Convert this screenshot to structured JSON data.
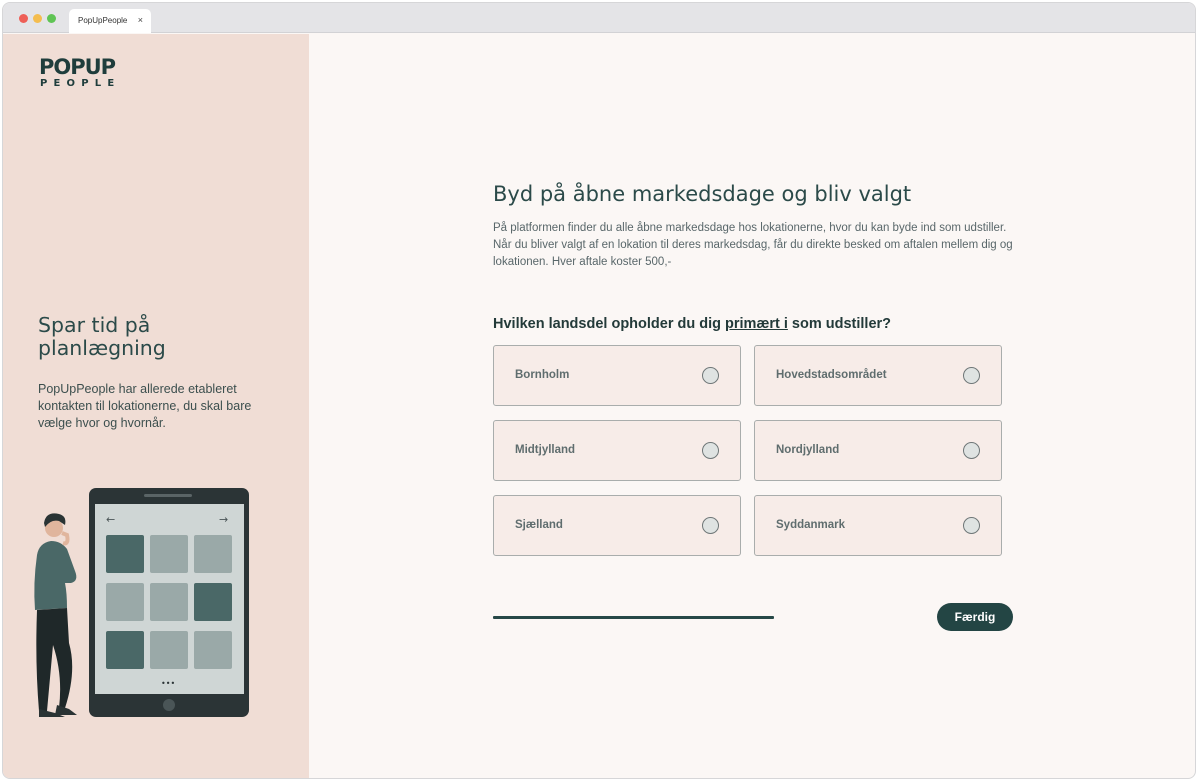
{
  "browser": {
    "tab_title": "PopUpPeople",
    "tab_close": "×"
  },
  "logo": {
    "line1": "POPUP",
    "line2": "PEOPLE"
  },
  "sidebar": {
    "title": "Spar tid på planlægning",
    "text": "PopUpPeople har allerede etableret kontakten til lokationerne, du skal bare vælge hvor og hvornår."
  },
  "illustration": {
    "arrow_left": "←",
    "arrow_right": "→",
    "dots": "•••"
  },
  "main": {
    "title": "Byd på åbne markedsdage og bliv valgt",
    "description": "På platformen finder du alle åbne markedsdage hos lokationerne, hvor du kan byde ind som udstiller. Når du bliver valgt af en lokation til deres markedsdag, får du direkte besked om aftalen mellem dig og lokationen. Hver aftale koster 500,-",
    "question_before": "Hvilken landsdel opholder du dig ",
    "question_underlined": "primært i",
    "question_after": " som udstiller?",
    "options": [
      {
        "label": "Bornholm"
      },
      {
        "label": "Hovedstadsområdet"
      },
      {
        "label": "Midtjylland"
      },
      {
        "label": "Nordjylland"
      },
      {
        "label": "Sjælland"
      },
      {
        "label": "Syddanmark"
      }
    ],
    "done_label": "Færdig"
  },
  "colors": {
    "accent": "#234544",
    "sidebar_bg": "#f0ddd5",
    "main_bg": "#fbf7f5",
    "option_bg": "#f7ece8"
  }
}
